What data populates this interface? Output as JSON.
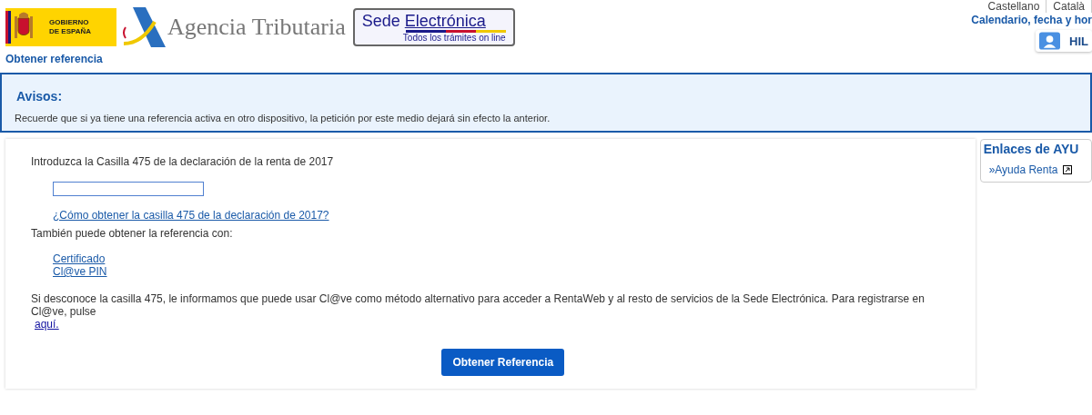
{
  "header": {
    "gov_logo": {
      "line1": "GOBIERNO",
      "line2": "DE ESPAÑA"
    },
    "agency_name": "Agencia Tributaria",
    "sede": {
      "title_a": "Sede",
      "title_b": "Electrónica",
      "subtitle": "Todos los trámites on line"
    },
    "languages": [
      "Castellano",
      "Català"
    ],
    "calendar_link": "Calendario, fecha y hor",
    "user_name": "HIL"
  },
  "page_title": "Obtener referencia",
  "notice": {
    "title": "Avisos:",
    "text": "Recuerde que si ya tiene una referencia activa en otro dispositivo, la petición por este medio dejará sin efecto la anterior."
  },
  "form": {
    "prompt": "Introduzca la Casilla 475 de la declaración de la renta de 2017",
    "help_link": "¿Cómo obtener la casilla 475 de la declaración de 2017?",
    "alt_text": "También puede obtener la referencia con:",
    "alt_links": [
      "Certificado",
      "Cl@ve PIN"
    ],
    "info_text": "Si desconoce la casilla 475, le informamos que puede usar Cl@ve como método alternativo para acceder a RentaWeb y al resto de servicios de la Sede Electrónica. Para registrarse en Cl@ve, pulse",
    "info_link": "aquí.",
    "submit": "Obtener Referencia"
  },
  "sidebar": {
    "title": "Enlaces de AYU",
    "links": [
      "»Ayuda Renta"
    ]
  }
}
